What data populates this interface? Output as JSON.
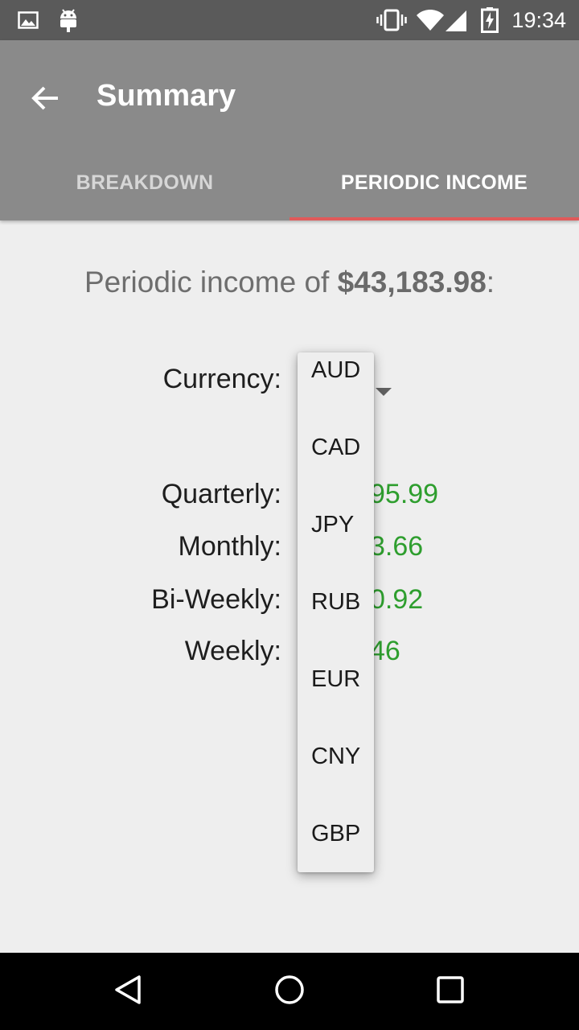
{
  "status_bar": {
    "time": "19:34",
    "icons": [
      "image-icon",
      "android-icon",
      "vibrate-icon",
      "wifi-icon",
      "signal-icon",
      "battery-charging-icon"
    ]
  },
  "app_bar": {
    "title": "Summary",
    "back_icon": "arrow-back-icon"
  },
  "tabs": [
    {
      "label": "BREAKDOWN",
      "active": false
    },
    {
      "label": "PERIODIC INCOME",
      "active": true
    }
  ],
  "headline": {
    "prefix": "Periodic income of ",
    "amount": "$43,183.98",
    "suffix": ":"
  },
  "currency": {
    "label": "Currency:",
    "options": [
      "AUD",
      "CAD",
      "JPY",
      "RUB",
      "EUR",
      "CNY",
      "GBP"
    ]
  },
  "rows": [
    {
      "label": "Quarterly:",
      "value_visible": "95.99"
    },
    {
      "label": "Monthly:",
      "value_visible": "3.66"
    },
    {
      "label": "Bi-Weekly:",
      "value_visible": "0.92"
    },
    {
      "label": "Weekly:",
      "value_visible": "46"
    }
  ],
  "colors": {
    "accent": "#e05a5a",
    "value_green": "#2e9e2e",
    "app_bar": "#8a8a8a",
    "status_bar": "#5a5a5a"
  },
  "nav_bar": {
    "icons": [
      "back-triangle-icon",
      "home-circle-icon",
      "recents-square-icon"
    ]
  }
}
